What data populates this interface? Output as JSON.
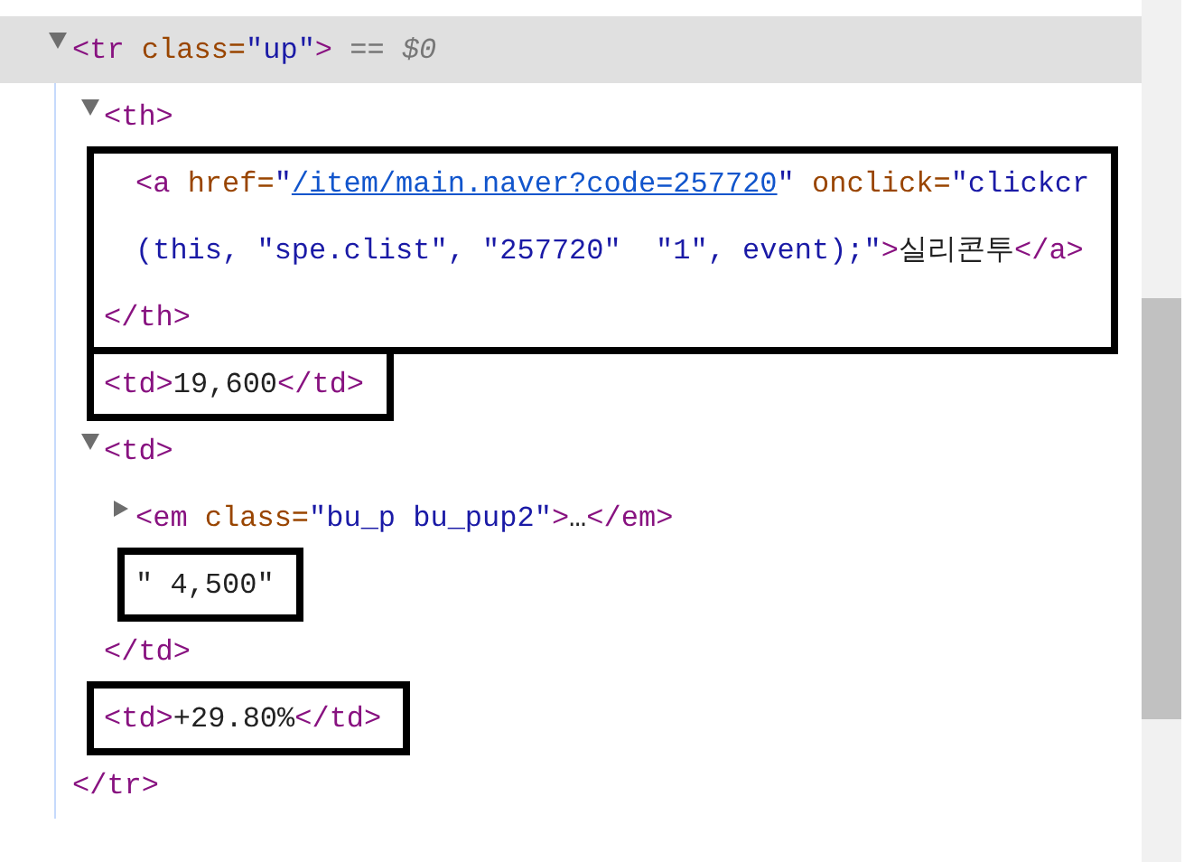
{
  "nodes": [
    {
      "selected": true,
      "expanded": true,
      "open": [
        [
          {
            "kind": "tag",
            "text": "<tr "
          },
          {
            "kind": "attr",
            "text": "class="
          },
          {
            "kind": "value",
            "text": "\"up\""
          },
          {
            "kind": "tag",
            "text": ">"
          },
          {
            "kind": "dim",
            "text": " == "
          },
          {
            "kind": "dimi",
            "text": "$0"
          }
        ]
      ],
      "children": [
        {
          "expanded": true,
          "boxed_body": true,
          "open": [
            [
              {
                "kind": "tag",
                "text": "<th>"
              }
            ]
          ],
          "children": [
            {
              "open": [
                [
                  {
                    "kind": "tag",
                    "text": "<a "
                  },
                  {
                    "kind": "attr",
                    "text": "href="
                  },
                  {
                    "kind": "value",
                    "text": "\""
                  },
                  {
                    "kind": "link",
                    "text": "/item/main.naver?code=257720"
                  },
                  {
                    "kind": "value",
                    "text": "\""
                  },
                  {
                    "kind": "attr",
                    "text": " onclick="
                  },
                  {
                    "kind": "value",
                    "text": "\"clickcr"
                  }
                ],
                [
                  {
                    "kind": "value",
                    "text": "(this, \"spe.clist\", \"257720\"  \"1\", event);\""
                  },
                  {
                    "kind": "tag",
                    "text": ">"
                  },
                  {
                    "kind": "text",
                    "text": "실리콘투"
                  },
                  {
                    "kind": "tag",
                    "text": "</a>"
                  }
                ]
              ]
            }
          ],
          "close": [
            {
              "kind": "tag",
              "text": "</th>"
            }
          ]
        },
        {
          "boxed": true,
          "open": [
            [
              {
                "kind": "tag",
                "text": "<td>"
              },
              {
                "kind": "text",
                "text": "19,600"
              },
              {
                "kind": "tag",
                "text": "</td>"
              }
            ]
          ]
        },
        {
          "expanded": true,
          "open": [
            [
              {
                "kind": "tag",
                "text": "<td>"
              }
            ]
          ],
          "children": [
            {
              "expanded": false,
              "open": [
                [
                  {
                    "kind": "tag",
                    "text": "<em "
                  },
                  {
                    "kind": "attr",
                    "text": "class="
                  },
                  {
                    "kind": "value",
                    "text": "\"bu_p bu_pup2\""
                  },
                  {
                    "kind": "tag",
                    "text": ">"
                  },
                  {
                    "kind": "text",
                    "text": "…"
                  },
                  {
                    "kind": "tag",
                    "text": "</em>"
                  }
                ]
              ]
            },
            {
              "boxed": true,
              "open": [
                [
                  {
                    "kind": "text",
                    "text": "\" 4,500\""
                  }
                ]
              ]
            }
          ],
          "close": [
            {
              "kind": "tag",
              "text": "</td>"
            }
          ]
        },
        {
          "boxed": true,
          "open": [
            [
              {
                "kind": "tag",
                "text": "<td>"
              },
              {
                "kind": "text",
                "text": "+29.80%"
              },
              {
                "kind": "tag",
                "text": "</td>"
              }
            ]
          ]
        }
      ],
      "close": [
        {
          "kind": "tag",
          "text": "</tr>"
        }
      ]
    }
  ]
}
